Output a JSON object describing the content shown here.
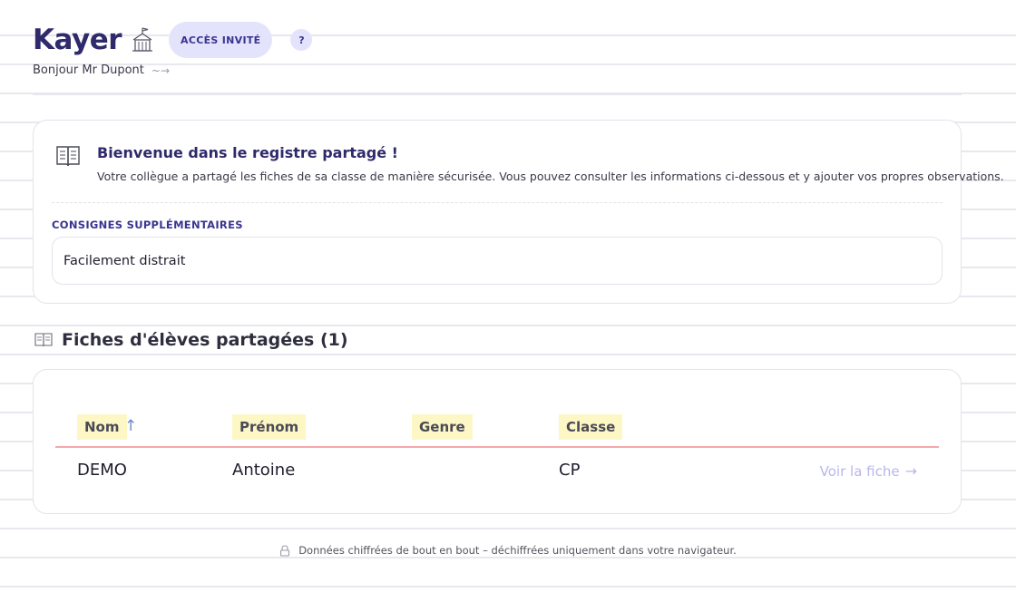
{
  "header": {
    "brand": "Kayer",
    "badge": "ACCÈS INVITÉ",
    "help": "?",
    "greeting": "Bonjour Mr Dupont",
    "wave": "~→"
  },
  "welcome": {
    "title": "Bienvenue dans le registre partagé !",
    "text": "Votre collègue a partagé les fiches de sa classe de manière sécurisée. Vous pouvez consulter les informations ci-dessous et y ajouter vos propres observations.",
    "consignes_label": "CONSIGNES SUPPLÉMENTAIRES",
    "consignes_value": "Facilement distrait"
  },
  "section": {
    "title": "Fiches d'élèves partagées (1)"
  },
  "table": {
    "columns": [
      "Nom",
      "Prénom",
      "Genre",
      "Classe"
    ],
    "sort_indicator": "↑",
    "rows": [
      {
        "nom": "DEMO",
        "prenom": "Antoine",
        "genre": "",
        "classe": "CP",
        "action": "Voir la fiche"
      }
    ],
    "action_arrow": "→"
  },
  "footer": {
    "text": "Données chiffrées de bout en bout – déchiffrées uniquement dans votre navigateur."
  },
  "icons": {
    "school": "school-icon",
    "book": "book-icon",
    "lock": "lock-icon"
  },
  "colors": {
    "brand": "#2e2a6b",
    "accent": "#3a3490",
    "badge_bg": "#e3e4fb",
    "header_highlight": "#fdf7c6",
    "divider": "#f3a9ad",
    "link": "#b9b6ea"
  }
}
